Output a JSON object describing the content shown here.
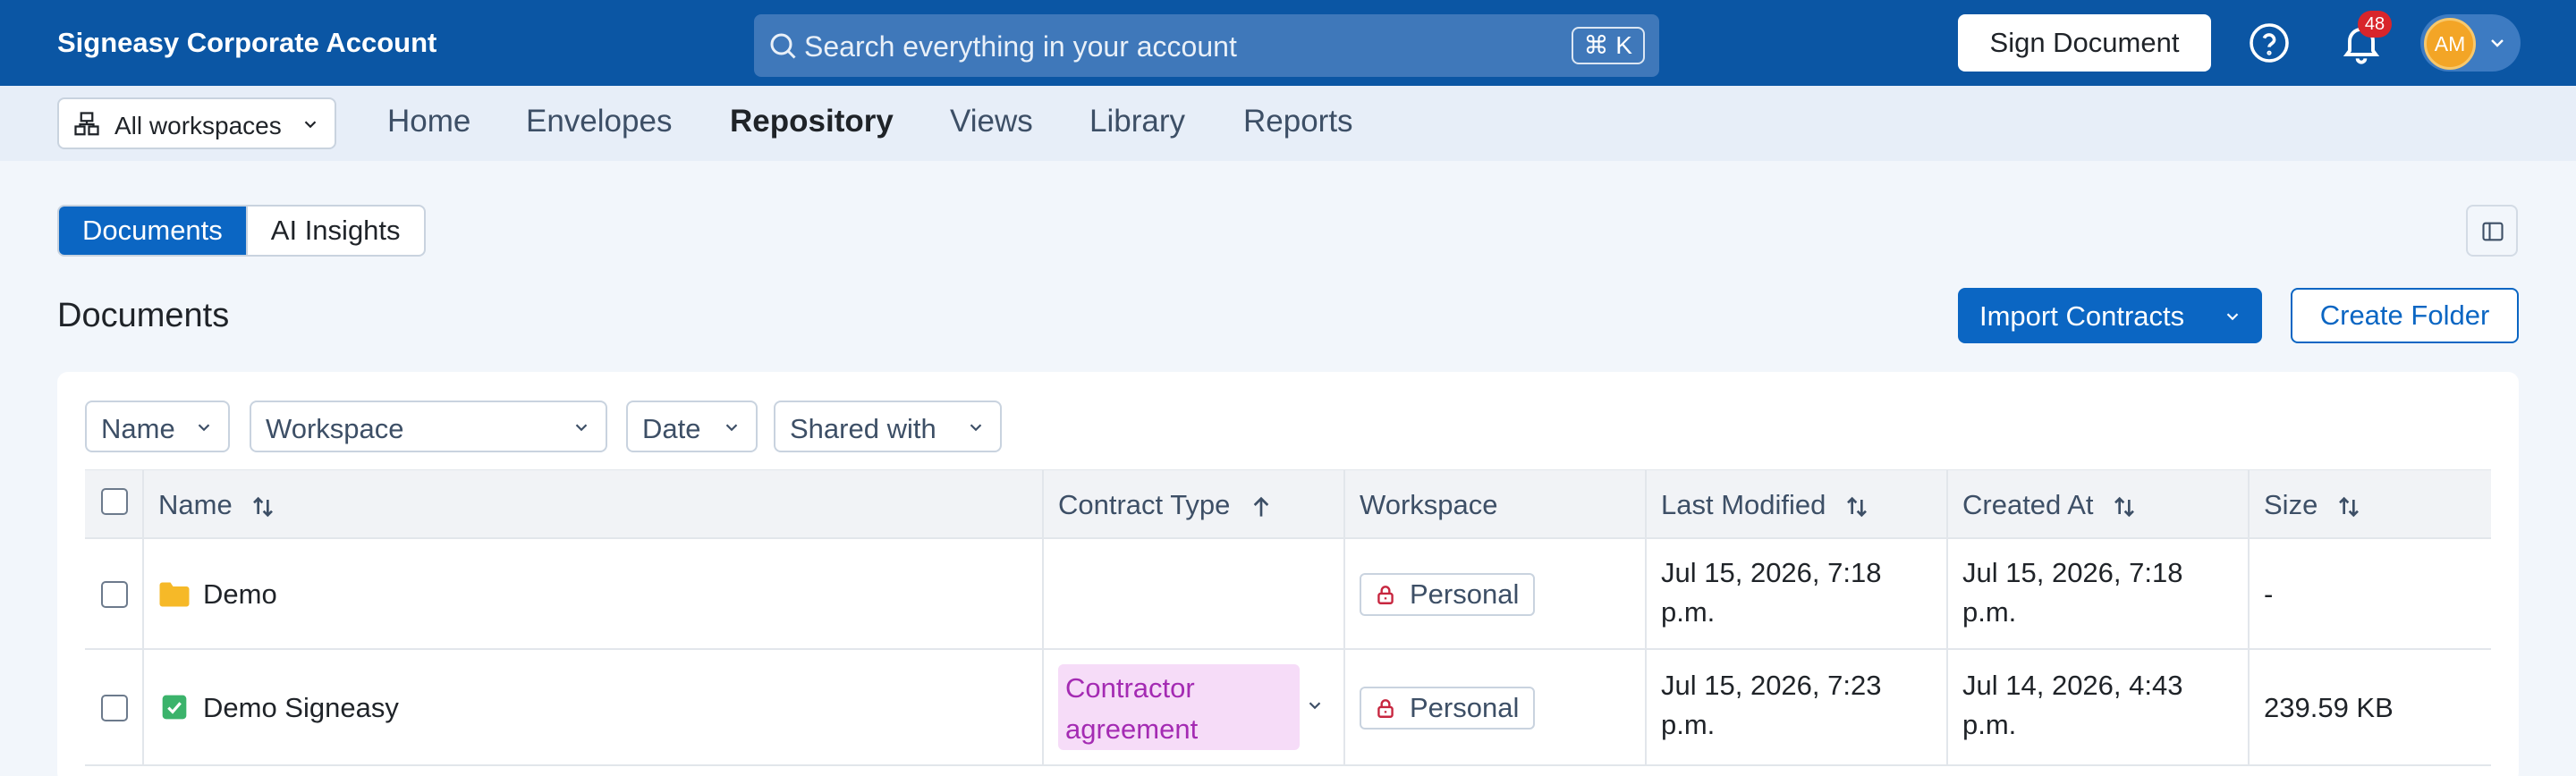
{
  "header": {
    "brand": "Signeasy Corporate Account",
    "search_placeholder": "Search everything in your account",
    "shortcut": "⌘ K",
    "sign_button": "Sign Document",
    "notification_count": "48",
    "avatar_initials": "AM"
  },
  "subnav": {
    "workspace_selector": "All workspaces",
    "items": [
      {
        "label": "Home",
        "active": false
      },
      {
        "label": "Envelopes",
        "active": false
      },
      {
        "label": "Repository",
        "active": true
      },
      {
        "label": "Views",
        "active": false
      },
      {
        "label": "Library",
        "active": false
      },
      {
        "label": "Reports",
        "active": false
      }
    ]
  },
  "tabs": [
    {
      "label": "Documents",
      "active": true
    },
    {
      "label": "AI Insights",
      "active": false
    }
  ],
  "section": {
    "title": "Documents",
    "import_button": "Import Contracts",
    "create_folder_button": "Create Folder"
  },
  "filters": [
    "Name",
    "Workspace",
    "Date",
    "Shared with"
  ],
  "table": {
    "columns": [
      "Name",
      "Contract Type",
      "Workspace",
      "Last Modified",
      "Created At",
      "Size"
    ],
    "rows": [
      {
        "icon": "folder-icon",
        "name": "Demo",
        "contract_type": "",
        "workspace": "Personal",
        "last_modified_line1": "Jul 15, 2026, 7:18",
        "last_modified_line2": "p.m.",
        "created_at_line1": "Jul 15, 2026, 7:18",
        "created_at_line2": "p.m.",
        "size": "-"
      },
      {
        "icon": "signed-document-icon",
        "name": "Demo Signeasy",
        "contract_type_line1": "Contractor",
        "contract_type_line2": "agreement",
        "workspace": "Personal",
        "last_modified_line1": "Jul 15, 2026, 7:23",
        "last_modified_line2": "p.m.",
        "created_at_line1": "Jul 14, 2026, 4:43",
        "created_at_line2": "p.m.",
        "size": "239.59 KB"
      }
    ]
  },
  "colors": {
    "header_bg": "#0b56a4",
    "primary": "#0b66c3",
    "badge": "#d8252b",
    "avatar": "#f3a526",
    "contract_pill_bg": "#f6dcf8",
    "contract_pill_text": "#a42bb3",
    "folder": "#f6b928",
    "signed_doc": "#3bb36b"
  }
}
